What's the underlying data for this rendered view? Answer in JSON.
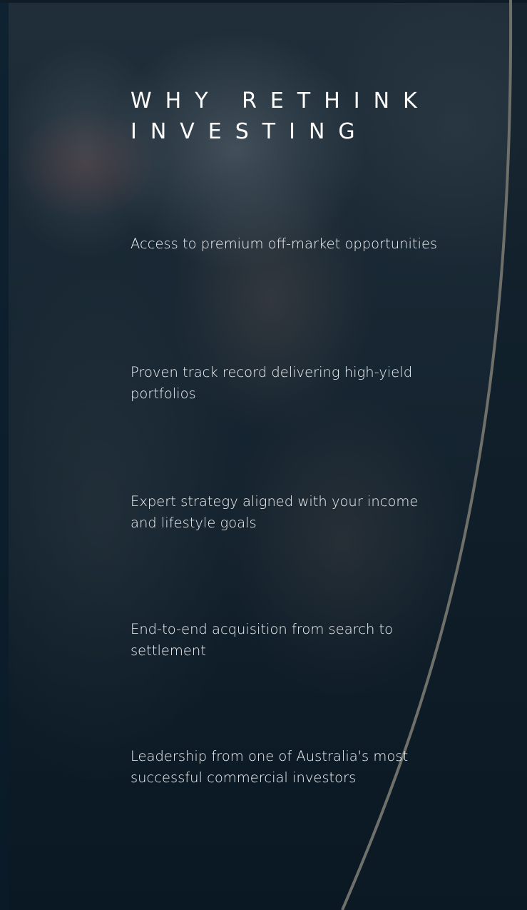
{
  "section": {
    "title": "WHY RETHINK INVESTING"
  },
  "features": [
    {
      "text": "Access to premium off-market opportunities"
    },
    {
      "text": "Proven track record delivering high-yield portfolios"
    },
    {
      "text": "Expert strategy aligned with your income and lifestyle goals"
    },
    {
      "text": "End-to-end acquisition from search to settlement"
    },
    {
      "text": "Leadership from one of Australia's most successful commercial investors"
    }
  ],
  "colors": {
    "background": "#0e1e2b",
    "text": "#ffffff",
    "arc_stroke": "#6f706a"
  }
}
